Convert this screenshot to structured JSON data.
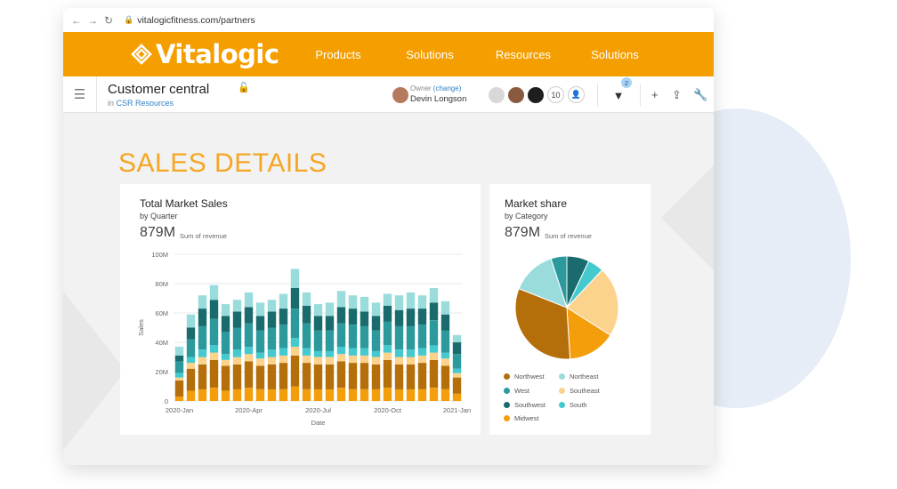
{
  "browser": {
    "url": "vitalogicfitness.com/partners"
  },
  "brand": {
    "name": "Vitalogic"
  },
  "menu": {
    "items": [
      "Products",
      "Solutions",
      "Resources",
      "Solutions"
    ]
  },
  "toolbar": {
    "title": "Customer central",
    "sub_prefix": "in",
    "sub_link": "CSR Resources",
    "owner_label": "Owner",
    "owner_change": "(change)",
    "owner_name": "Devin Longson",
    "member_count": "10",
    "filter_count": "2"
  },
  "colors": {
    "brand": "#f59e00",
    "title_orange": "#f5a623",
    "northwest": "#b56f0a",
    "southeast": "#fbd38d",
    "midwest": "#f59e0b",
    "west": "#2c9a9d",
    "southwest": "#1a6b6d",
    "northeast": "#9adcdc",
    "south": "#44c9cf"
  },
  "icons": {
    "back": "arrow-left-icon",
    "forward": "arrow-right-icon",
    "reload": "reload-icon",
    "menu": "hamburger-icon",
    "lock": "unlock-icon",
    "filter": "filter-icon",
    "add": "plus-icon",
    "share": "share-icon",
    "settings": "wrench-icon"
  },
  "page": {
    "title": "SALES DETAILS"
  },
  "chart_data": [
    {
      "type": "bar",
      "stacked": true,
      "title": "Total Market Sales",
      "subtitle": "by Quarter",
      "kpi": "879M",
      "kpi_label": "Sum of revenue",
      "xlabel": "Date",
      "ylabel": "Sales",
      "ylim": [
        0,
        100
      ],
      "yticks": [
        "0",
        "20M",
        "40M",
        "60M",
        "80M",
        "100M"
      ],
      "xticks": [
        "2020-Jan",
        "2020-Apr",
        "2020-Jul",
        "2020-Oct",
        "2021-Jan"
      ],
      "grid": true,
      "series": [
        {
          "key": "midwest",
          "values": [
            3,
            7,
            8,
            9,
            7,
            8,
            9,
            8,
            8,
            8,
            10,
            8,
            8,
            8,
            9,
            8,
            8,
            8,
            9,
            8,
            8,
            8,
            9,
            8,
            5
          ]
        },
        {
          "key": "northwest",
          "values": [
            11,
            15,
            17,
            19,
            17,
            17,
            18,
            16,
            17,
            18,
            21,
            18,
            17,
            17,
            18,
            18,
            18,
            17,
            19,
            17,
            17,
            18,
            19,
            16,
            11
          ]
        },
        {
          "key": "southeast",
          "values": [
            2,
            4,
            5,
            5,
            4,
            5,
            5,
            5,
            5,
            5,
            6,
            5,
            5,
            5,
            5,
            5,
            5,
            5,
            5,
            5,
            5,
            5,
            5,
            5,
            3
          ]
        },
        {
          "key": "south",
          "values": [
            3,
            4,
            5,
            5,
            4,
            5,
            5,
            4,
            5,
            5,
            6,
            5,
            4,
            4,
            5,
            5,
            5,
            4,
            5,
            5,
            5,
            5,
            5,
            4,
            3
          ]
        },
        {
          "key": "west",
          "values": [
            8,
            12,
            16,
            18,
            15,
            15,
            16,
            15,
            15,
            16,
            20,
            17,
            14,
            14,
            16,
            16,
            15,
            14,
            16,
            16,
            16,
            16,
            17,
            15,
            10
          ]
        },
        {
          "key": "southwest",
          "values": [
            4,
            8,
            12,
            13,
            11,
            11,
            11,
            10,
            11,
            11,
            14,
            12,
            10,
            10,
            11,
            11,
            10,
            10,
            11,
            11,
            12,
            11,
            12,
            11,
            8
          ]
        },
        {
          "key": "northeast",
          "values": [
            6,
            9,
            9,
            10,
            8,
            8,
            10,
            9,
            8,
            10,
            13,
            9,
            8,
            9,
            11,
            9,
            10,
            9,
            8,
            10,
            11,
            9,
            10,
            9,
            5
          ]
        }
      ]
    },
    {
      "type": "pie",
      "title": "Market share",
      "subtitle": "by Category",
      "kpi": "879M",
      "kpi_label": "Sum of revenue",
      "slices": [
        {
          "label": "Southwest",
          "key": "southwest",
          "value": 7
        },
        {
          "label": "South",
          "key": "south",
          "value": 5
        },
        {
          "label": "Southeast",
          "key": "southeast",
          "value": 22
        },
        {
          "label": "Midwest",
          "key": "midwest",
          "value": 15
        },
        {
          "label": "Northwest",
          "key": "northwest",
          "value": 32
        },
        {
          "label": "Northeast",
          "key": "northeast",
          "value": 14
        },
        {
          "label": "West",
          "key": "west",
          "value": 5
        }
      ],
      "legend": [
        {
          "label": "Northwest",
          "key": "northwest"
        },
        {
          "label": "Northeast",
          "key": "northeast"
        },
        {
          "label": "West",
          "key": "west"
        },
        {
          "label": "Southeast",
          "key": "southeast"
        },
        {
          "label": "Southwest",
          "key": "southwest"
        },
        {
          "label": "South",
          "key": "south"
        },
        {
          "label": "Midwest",
          "key": "midwest"
        }
      ]
    }
  ]
}
